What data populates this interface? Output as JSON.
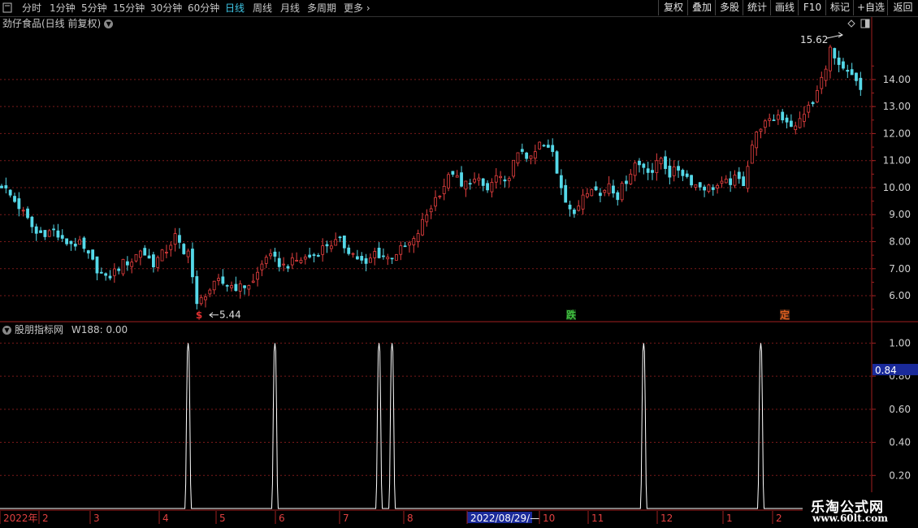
{
  "toolbar": {
    "periods": [
      {
        "label": "分时",
        "active": false
      },
      {
        "label": "1分钟",
        "active": false
      },
      {
        "label": "5分钟",
        "active": false
      },
      {
        "label": "15分钟",
        "active": false
      },
      {
        "label": "30分钟",
        "active": false
      },
      {
        "label": "60分钟",
        "active": false
      },
      {
        "label": "日线",
        "active": true
      },
      {
        "label": "周线",
        "active": false
      },
      {
        "label": "月线",
        "active": false
      },
      {
        "label": "多周期",
        "active": false
      },
      {
        "label": "更多",
        "active": false
      }
    ],
    "buttons": [
      "复权",
      "叠加",
      "多股",
      "统计",
      "画线",
      "F10",
      "标记",
      "+自选",
      "返回"
    ]
  },
  "main_panel": {
    "title": "劲仔食品(日线 前复权)",
    "high_label": "15.62",
    "low_label": "5.44",
    "markers": [
      {
        "text": "$",
        "color": "#e03030"
      },
      {
        "text": "跌",
        "color": "#40c040"
      },
      {
        "text": "定",
        "color": "#e06020"
      }
    ],
    "colors": {
      "up": "#e84040",
      "down": "#55d8e8",
      "grid": "#7a1a1a",
      "axis": "#a02020"
    }
  },
  "indicator_panel": {
    "title": "股朋指标网",
    "value_label": "W188: 0.00",
    "cursor_value": "0.84"
  },
  "date_axis": {
    "labels": [
      "2022年",
      "2",
      "3",
      "4",
      "5",
      "6",
      "7",
      "8",
      "2022/08/29/—",
      "10",
      "11",
      "12",
      "1",
      "2"
    ],
    "highlight": "2022/08/29/—"
  },
  "watermark": {
    "line1": "乐淘公式网",
    "line2": "www.60lt.com"
  },
  "chart_data": [
    {
      "type": "candlestick",
      "title": "劲仔食品(日线 前复权)",
      "y_ticks": [
        6.0,
        7.0,
        8.0,
        9.0,
        10.0,
        11.0,
        12.0,
        13.0,
        14.0
      ],
      "ylim": [
        5.1,
        15.8
      ],
      "annotations": [
        {
          "text": "15.62",
          "value": 15.62
        },
        {
          "text": "5.44",
          "value": 5.44
        }
      ],
      "close_path": [
        [
          0,
          10.1
        ],
        [
          4,
          9.3
        ],
        [
          8,
          8.3
        ],
        [
          12,
          8.4
        ],
        [
          14,
          8.0
        ],
        [
          18,
          7.9
        ],
        [
          22,
          7.0
        ],
        [
          24,
          6.6
        ],
        [
          28,
          7.2
        ],
        [
          30,
          7.3
        ],
        [
          32,
          7.7
        ],
        [
          35,
          7.2
        ],
        [
          38,
          7.7
        ],
        [
          40,
          8.2
        ],
        [
          42,
          7.5
        ],
        [
          43,
          7.8
        ],
        [
          45,
          5.6
        ],
        [
          47,
          6.1
        ],
        [
          50,
          6.5
        ],
        [
          55,
          6.3
        ],
        [
          58,
          6.5
        ],
        [
          61,
          7.5
        ],
        [
          65,
          7.1
        ],
        [
          68,
          7.3
        ],
        [
          72,
          7.5
        ],
        [
          75,
          7.9
        ],
        [
          78,
          8.0
        ],
        [
          80,
          7.7
        ],
        [
          84,
          7.1
        ],
        [
          86,
          7.6
        ],
        [
          89,
          7.4
        ],
        [
          92,
          7.7
        ],
        [
          95,
          8.0
        ],
        [
          97,
          8.7
        ],
        [
          100,
          9.6
        ],
        [
          102,
          10.1
        ],
        [
          104,
          10.6
        ],
        [
          106,
          10.0
        ],
        [
          108,
          10.3
        ],
        [
          110,
          10.2
        ],
        [
          112,
          9.9
        ],
        [
          114,
          10.4
        ],
        [
          116,
          10.1
        ],
        [
          118,
          10.9
        ],
        [
          120,
          11.4
        ],
        [
          122,
          11.0
        ],
        [
          124,
          11.6
        ],
        [
          127,
          11.3
        ],
        [
          128,
          10.6
        ],
        [
          130,
          9.6
        ],
        [
          132,
          8.9
        ],
        [
          134,
          9.8
        ],
        [
          136,
          10.1
        ],
        [
          138,
          9.7
        ],
        [
          140,
          10.2
        ],
        [
          142,
          9.7
        ],
        [
          144,
          10.3
        ],
        [
          146,
          10.9
        ],
        [
          148,
          10.8
        ],
        [
          150,
          10.6
        ],
        [
          152,
          11.1
        ],
        [
          154,
          10.5
        ],
        [
          156,
          10.7
        ],
        [
          158,
          10.4
        ],
        [
          160,
          10.1
        ],
        [
          163,
          10.0
        ],
        [
          166,
          10.1
        ],
        [
          169,
          10.3
        ],
        [
          171,
          10.2
        ],
        [
          173,
          11.6
        ],
        [
          175,
          12.3
        ],
        [
          177,
          12.4
        ],
        [
          179,
          12.7
        ],
        [
          181,
          12.5
        ],
        [
          183,
          12.2
        ],
        [
          185,
          12.8
        ],
        [
          187,
          13.1
        ],
        [
          189,
          14.0
        ],
        [
          191,
          15.1
        ],
        [
          193,
          14.4
        ],
        [
          196,
          14.1
        ],
        [
          198,
          13.6
        ]
      ],
      "n_days": 200
    },
    {
      "type": "line",
      "title": "股朋指标网",
      "series": [
        {
          "name": "W188",
          "values": [
            0,
            1,
            0,
            1,
            0,
            1,
            0,
            1,
            0,
            1,
            0,
            1,
            0
          ]
        }
      ],
      "x": [
        0.0,
        0.2,
        0.4,
        0.6,
        0.8,
        1.0,
        1.2,
        1.4,
        1.6,
        1.8,
        2.0,
        2.2,
        2.4
      ],
      "spikes_at_day": [
        43,
        63,
        87,
        90,
        148,
        175
      ],
      "y_ticks": [
        0.2,
        0.4,
        0.6,
        0.8,
        1.0
      ],
      "ylim": [
        0,
        1.1
      ],
      "current_value": 0.0,
      "cursor_value": 0.84
    }
  ]
}
